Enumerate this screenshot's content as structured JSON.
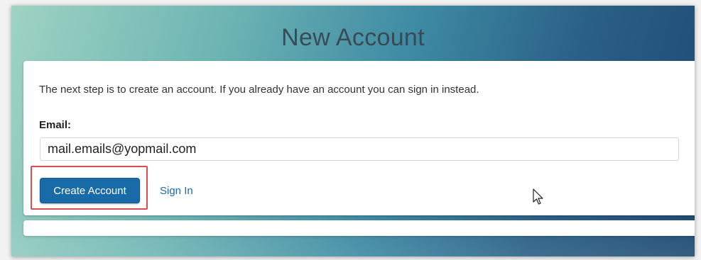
{
  "page": {
    "title": "New Account"
  },
  "card": {
    "intro_text": "The next step is to create an account. If you already have an account you can sign in instead.",
    "email_label": "Email:",
    "email_value": "mail.emails@yopmail.com"
  },
  "actions": {
    "create_account_label": "Create Account",
    "sign_in_label": "Sign In"
  },
  "colors": {
    "primary_button": "#186ba6",
    "link": "#1d6aa5",
    "highlight": "#e34a4f"
  },
  "icons": {
    "cursor": "mouse-pointer-icon"
  }
}
